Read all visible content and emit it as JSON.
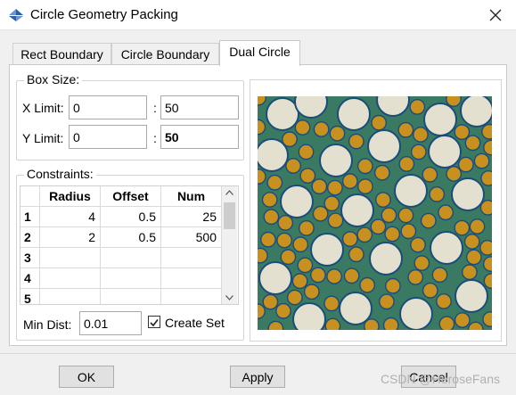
{
  "window": {
    "title": "Circle Geometry Packing"
  },
  "tabs": [
    {
      "label": "Rect Boundary"
    },
    {
      "label": "Circle Boundary"
    },
    {
      "label": "Dual Circle"
    }
  ],
  "box_size": {
    "legend": "Box Size:",
    "x_label": "X Limit:",
    "x_min": "0",
    "x_max": "50",
    "y_label": "Y Limit:",
    "y_min": "0",
    "y_max": "50",
    "sep": ":"
  },
  "constraints": {
    "legend": "Constraints:",
    "headers": [
      "Radius",
      "Offset",
      "Num"
    ],
    "rows": [
      {
        "n": "1",
        "radius": "4",
        "offset": "0.5",
        "num": "25"
      },
      {
        "n": "2",
        "radius": "2",
        "offset": "0.5",
        "num": "500"
      },
      {
        "n": "3",
        "radius": "",
        "offset": "",
        "num": ""
      },
      {
        "n": "4",
        "radius": "",
        "offset": "",
        "num": ""
      },
      {
        "n": "5",
        "radius": "",
        "offset": "",
        "num": ""
      }
    ]
  },
  "min_dist": {
    "label": "Min Dist:",
    "value": "0.01"
  },
  "create_set": {
    "label": "Create Set",
    "checked": true
  },
  "buttons": {
    "ok": "OK",
    "apply": "Apply",
    "cancel": "Cancel"
  },
  "watermark": "CSDN @HeroseFans",
  "colors": {
    "packing_background": "#3a7a62",
    "large_circle": "#e3e0cf",
    "small_circle": "#c7901f",
    "circle_outline": "#1a4c7a"
  }
}
